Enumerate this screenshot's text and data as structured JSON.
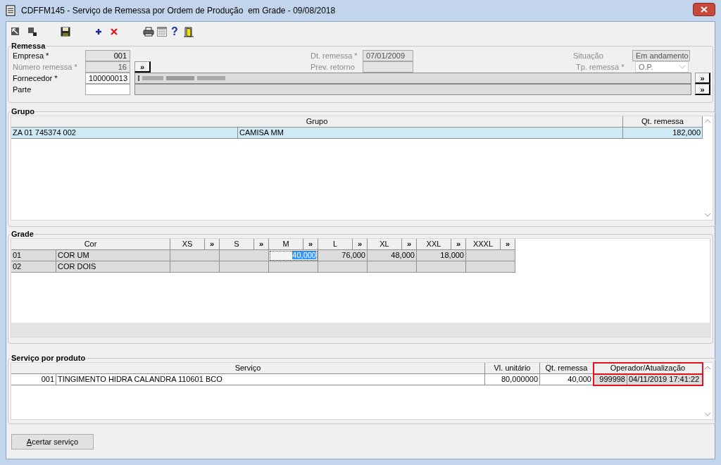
{
  "window": {
    "title": "CDFFM145 - Serviço de Remessa por Ordem de Produção  em Grade - 09/08/2018"
  },
  "toolbar": {
    "help_glyph": "?"
  },
  "remessa": {
    "title": "Remessa",
    "empresa": {
      "label": "Empresa *",
      "value": "001",
      "disabled": false
    },
    "numero": {
      "label": "Número remessa *",
      "value": "16",
      "disabled": true
    },
    "fornecedor": {
      "label": "Fornecedor *",
      "value": "100000013",
      "disabled": false
    },
    "parte": {
      "label": "Parte",
      "disabled": false
    },
    "dt_remessa": {
      "label": "Dt. remessa *",
      "value": "07/01/2009",
      "disabled": true
    },
    "prev_retorno": {
      "label": "Prev. retorno",
      "disabled": true
    },
    "situacao": {
      "label": "Situação",
      "value": "Em andamento",
      "disabled": true
    },
    "tp_remessa": {
      "label": "Tp. remessa *",
      "value": "O.P.",
      "disabled": true
    },
    "lookup_button": "»"
  },
  "grupo": {
    "title": "Grupo",
    "columns": [
      "Grupo",
      "Qt. remessa"
    ],
    "rows": [
      {
        "code": "ZA 01 745374 002",
        "name": "CAMISA MM",
        "qty": "182,000",
        "selected": true
      }
    ]
  },
  "grade": {
    "title": "Grade",
    "columns": [
      "Cor",
      "XS",
      "S",
      "M",
      "L",
      "XL",
      "XXL",
      "XXXL"
    ],
    "column_button": "»",
    "rows": [
      {
        "code": "01",
        "name": "COR UM",
        "sizes": [
          {
            "selected": false
          },
          {
            "selected": false
          },
          {
            "value": "40,000",
            "selected": true
          },
          {
            "value": "76,000",
            "selected": false
          },
          {
            "value": "48,000",
            "selected": false
          },
          {
            "value": "18,000",
            "selected": false
          },
          {
            "selected": false
          }
        ]
      },
      {
        "code": "02",
        "name": "COR DOIS",
        "sizes": [
          {
            "selected": false
          },
          {
            "selected": false
          },
          {
            "selected": false
          },
          {
            "selected": false
          },
          {
            "selected": false
          },
          {
            "selected": false
          },
          {
            "selected": false
          }
        ]
      }
    ]
  },
  "servico": {
    "title": "Serviço por produto",
    "columns": [
      {
        "label": "Serviço",
        "highlighted": false
      },
      {
        "label": "Vl. unitário",
        "highlighted": false
      },
      {
        "label": "Qt. remessa",
        "highlighted": false
      },
      {
        "label": "Operador/Atualização",
        "highlighted": true
      }
    ],
    "rows": [
      {
        "code": "001",
        "name": "TINGIMENTO HIDRA CALANDRA 110601 BCO",
        "unit_value": "80,000000",
        "qty": "40,000",
        "operator": "999998",
        "updated": "04/11/2019 17:41:22",
        "selected": false
      }
    ]
  },
  "buttons": [
    "Acertar serviço"
  ]
}
